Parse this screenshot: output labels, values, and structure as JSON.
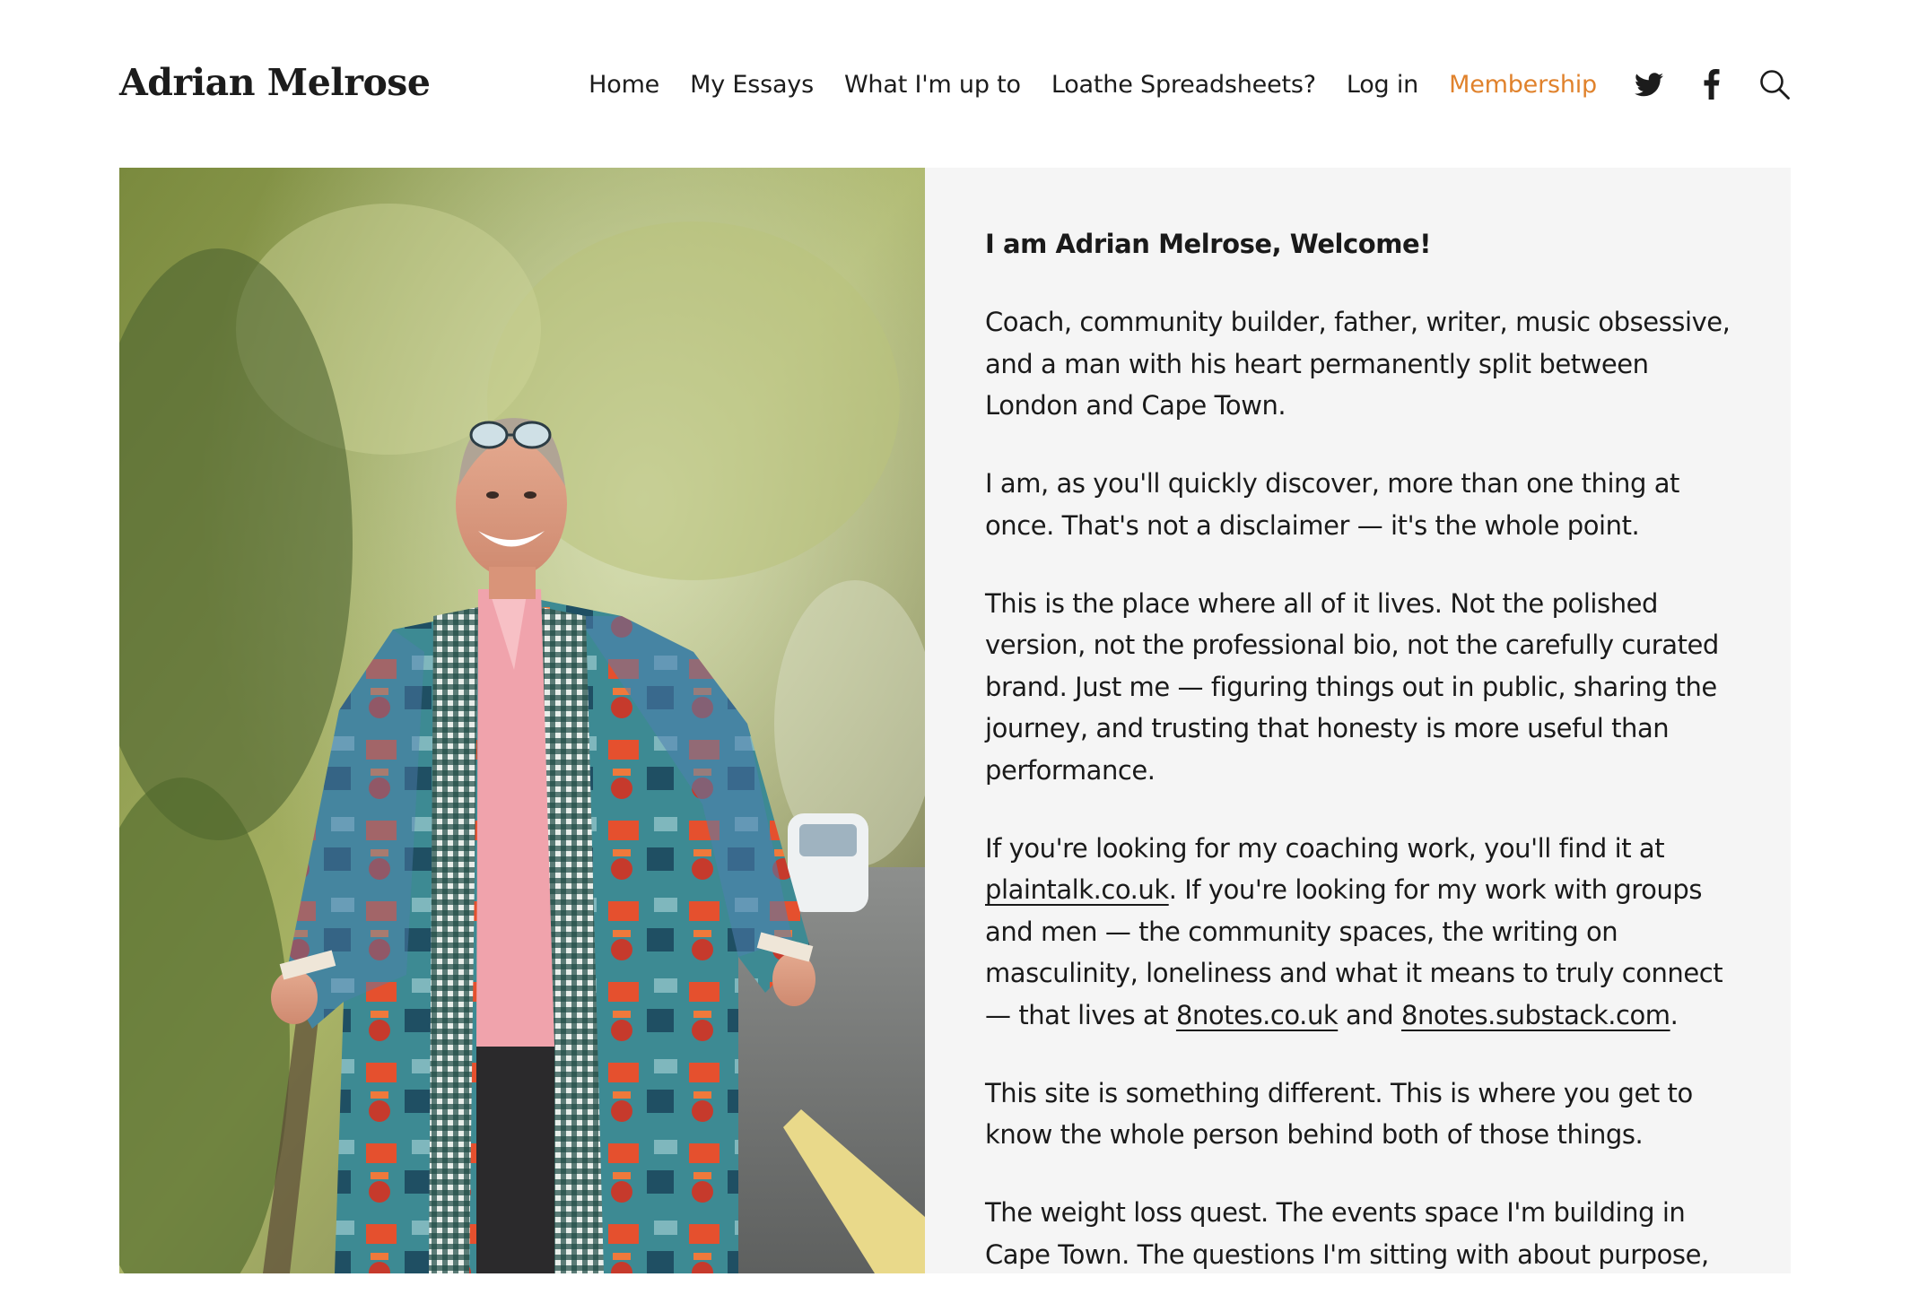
{
  "site": {
    "title": "Adrian Melrose"
  },
  "nav": {
    "items": [
      {
        "label": "Home"
      },
      {
        "label": "My Essays"
      },
      {
        "label": "What I'm up to"
      },
      {
        "label": "Loathe Spreadsheets?"
      },
      {
        "label": "Log in"
      },
      {
        "label": "Membership"
      }
    ],
    "accent_color": "#e0822c"
  },
  "social": {
    "icons": [
      "twitter-icon",
      "facebook-icon",
      "search-icon"
    ]
  },
  "hero": {
    "background_color": "#f5f5f5",
    "intro": "I am Adrian Melrose, Welcome!",
    "p1": "Coach, community builder, father, writer, music obsessive, and a man with his heart permanently split between London and Cape Town.",
    "p2": "I am, as you'll quickly discover, more than one thing at once. That's not a disclaimer — it's the whole point.",
    "p3": "This is the place where all of it lives. Not the polished version, not the professional bio, not the carefully curated brand. Just me — figuring things out in public, sharing the journey, and trusting that honesty is more useful than performance.",
    "p4": {
      "t1": "If you're looking for my coaching work, you'll find it at ",
      "link1": "plaintalk.co.uk",
      "t2": ". If you're looking for my work with groups and men — the community spaces, the writing on masculinity, loneliness and what it means to truly connect — that lives at ",
      "link2": "8notes.co.uk",
      "t3": " and ",
      "link3": "8notes.substack.com",
      "t4": "."
    },
    "p5": "This site is something different. This is where you get to know the whole person behind both of those things.",
    "p6": "The weight loss quest. The events space I'm building in Cape Town. The questions I'm sitting with about purpose,"
  }
}
